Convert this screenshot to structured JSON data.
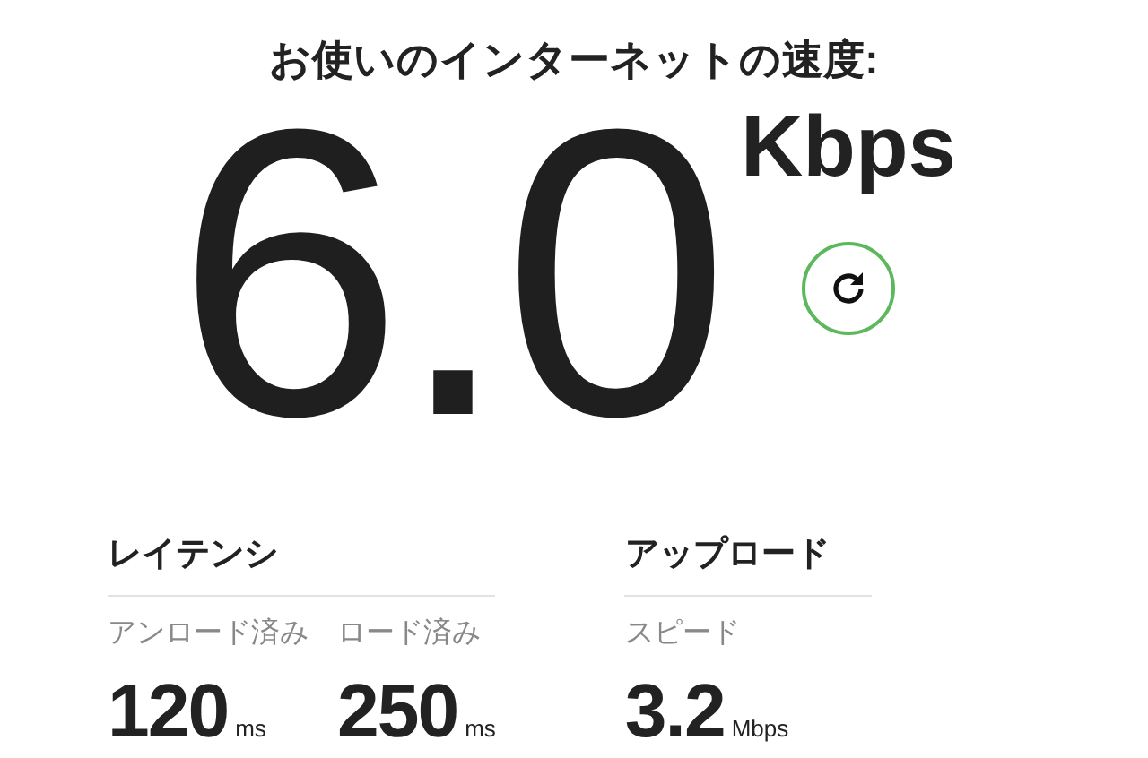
{
  "title": "お使いのインターネットの速度:",
  "speed": {
    "value": "6.0",
    "unit": "Kbps"
  },
  "sections": [
    {
      "heading": "レイテンシ",
      "metrics": [
        {
          "label": "アンロード済み",
          "value": "120",
          "unit": "ms"
        },
        {
          "label": "ロード済み",
          "value": "250",
          "unit": "ms"
        }
      ]
    },
    {
      "heading": "アップロード",
      "metrics": [
        {
          "label": "スピード",
          "value": "3.2",
          "unit": "Mbps"
        }
      ]
    }
  ]
}
